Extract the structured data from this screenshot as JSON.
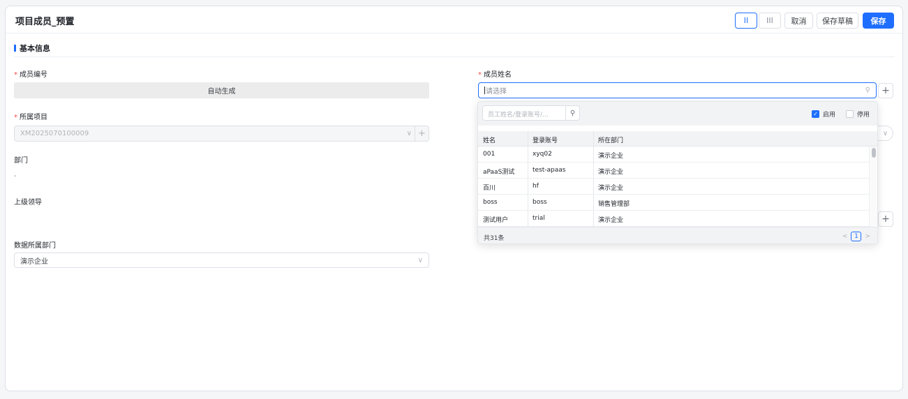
{
  "header": {
    "title": "项目成员_预置",
    "layout2_label": "II",
    "layout3_label": "III",
    "cancel_label": "取消",
    "draft_label": "保存草稿",
    "save_label": "保存"
  },
  "section": {
    "title": "基本信息"
  },
  "form": {
    "member_no": {
      "label": "成员编号",
      "value": "自动生成"
    },
    "project": {
      "label": "所属项目",
      "value": "XM2025070100009"
    },
    "department": {
      "label": "部门",
      "value": "-"
    },
    "leader": {
      "label": "上级领导"
    },
    "data_dept": {
      "label": "数据所属部门",
      "value": "演示企业"
    },
    "member_name": {
      "label": "成员姓名",
      "placeholder": "请选择"
    }
  },
  "dropdown": {
    "search_placeholder": "员工姓名/登录账号/...",
    "enabled_label": "启用",
    "disabled_label": "停用",
    "columns": [
      "姓名",
      "登录账号",
      "所在部门"
    ],
    "rows": [
      [
        "001",
        "xyq02",
        "演示企业"
      ],
      [
        "aPaaS测试",
        "test-apaas",
        "演示企业"
      ],
      [
        "百川",
        "hf",
        "演示企业"
      ],
      [
        "boss",
        "boss",
        "销售管理部"
      ],
      [
        "测试用户",
        "trial",
        "演示企业"
      ]
    ],
    "total": "共31条",
    "page": "1"
  },
  "icons": {
    "required_mark": "*",
    "chevron": "∨",
    "plus": "+",
    "search": "⚲",
    "check": "✓",
    "prev": "<",
    "next": ">"
  },
  "colors": {
    "accent": "#1e6fff",
    "required": "#f54a45"
  }
}
